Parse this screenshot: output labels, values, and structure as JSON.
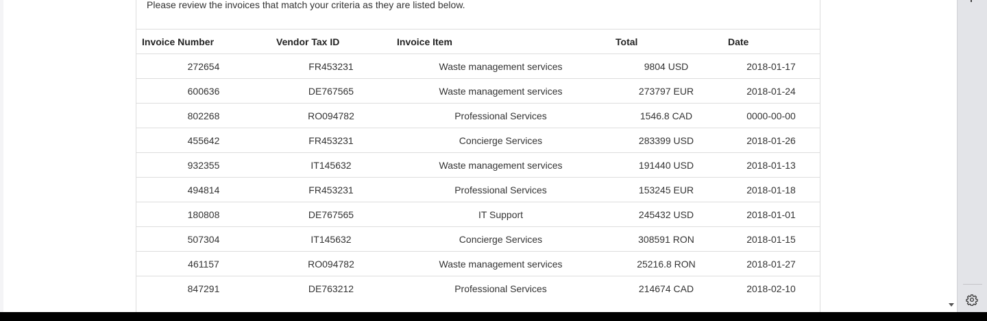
{
  "intro_text": "Please review the invoices that match your criteria as they are listed below.",
  "table": {
    "columns": [
      "Invoice Number",
      "Vendor Tax ID",
      "Invoice Item",
      "Total",
      "Date"
    ],
    "rows": [
      [
        "272654",
        "FR453231",
        "Waste management services",
        "9804 USD",
        "2018-01-17"
      ],
      [
        "600636",
        "DE767565",
        "Waste management services",
        "273797 EUR",
        "2018-01-24"
      ],
      [
        "802268",
        "RO094782",
        "Professional Services",
        "1546.8 CAD",
        "0000-00-00"
      ],
      [
        "455642",
        "FR453231",
        "Concierge Services",
        "283399 USD",
        "2018-01-26"
      ],
      [
        "932355",
        "IT145632",
        "Waste management services",
        "191440 USD",
        "2018-01-13"
      ],
      [
        "494814",
        "FR453231",
        "Professional Services",
        "153245 EUR",
        "2018-01-18"
      ],
      [
        "180808",
        "DE767565",
        "IT Support",
        "245432 USD",
        "2018-01-01"
      ],
      [
        "507304",
        "IT145632",
        "Concierge Services",
        "308591 RON",
        "2018-01-15"
      ],
      [
        "461157",
        "RO094782",
        "Waste management services",
        "25216.8 RON",
        "2018-01-27"
      ],
      [
        "847291",
        "DE763212",
        "Professional Services",
        "214674 CAD",
        "2018-02-10"
      ]
    ]
  },
  "icons": {
    "settings": "gear-icon",
    "scroll_down": "scroll-down-arrow-icon"
  },
  "colors": {
    "text": "#333333",
    "border": "#dddddd",
    "side_panel": "#e3e4e8",
    "taskbar": "#000000"
  }
}
